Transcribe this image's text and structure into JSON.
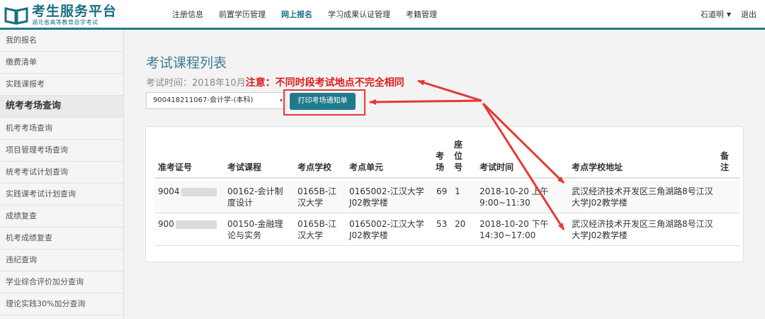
{
  "header": {
    "logo_title": "考生服务平台",
    "logo_sub": "湖北省高等教育自学考试",
    "nav": [
      "注册信息",
      "前置学历管理",
      "网上报名",
      "学习成果认证管理",
      "考籍管理"
    ],
    "user": "石道明",
    "logout": "退出"
  },
  "sidebar": {
    "items": [
      "我的报名",
      "缴费清单",
      "实践课报考",
      "统考考场查询",
      "机考考场查询",
      "项目管理考场查询",
      "统考考试计划查询",
      "实践课考试计划查询",
      "成绩复查",
      "机考成绩复查",
      "违纪查询",
      "学业综合评价加分查询",
      "理论实践30%加分查询"
    ]
  },
  "main": {
    "title": "考试课程列表",
    "exam_time": "考试时间：2018年10月",
    "notice": "注意：不同时段考试地点不完全相同",
    "select_value": "900418211067-会计学-(本科)",
    "print_button": "打印考场通知单",
    "table": {
      "headers": [
        "准考证号",
        "考试课程",
        "考点学校",
        "考点单元",
        "考场",
        "座位号",
        "考试时间",
        "考点学校地址",
        "备注"
      ],
      "rows": [
        {
          "id": "9004",
          "course": "00162-会计制度设计",
          "school": "0165B-江汉大学",
          "unit": "0165002-江汉大学J02教学楼",
          "room": "69",
          "seat": "1",
          "time": "2018-10-20 上午9:00~11:30",
          "address": "武汉经济技术开发区三角湖路8号江汉大学J02教学楼",
          "remark": ""
        },
        {
          "id": "900",
          "course": "00150-金融理论与实务",
          "school": "0165B-江汉大学",
          "unit": "0165002-江汉大学J02教学楼",
          "room": "53",
          "seat": "20",
          "time": "2018-10-20 下午14:30~17:00",
          "address": "武汉经济技术开发区三角湖路8号江汉大学J02教学楼",
          "remark": ""
        }
      ]
    }
  },
  "colors": {
    "accent": "#1f7a8c",
    "notice": "#e01b1b",
    "annotation": "#e53935"
  }
}
